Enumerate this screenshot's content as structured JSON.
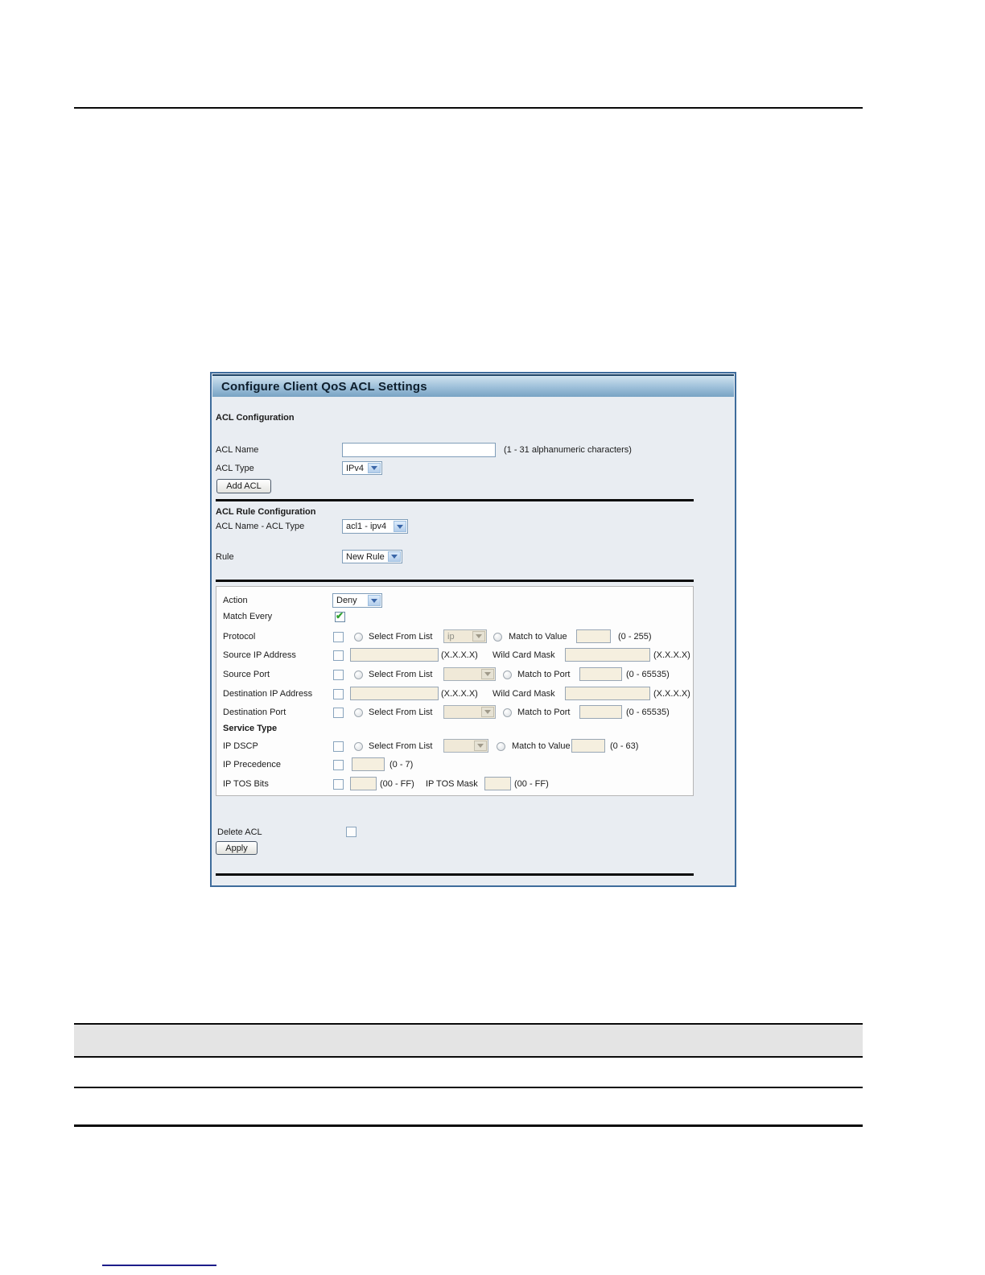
{
  "colors": {
    "panel_border": "#3f6c9c",
    "panel_bg": "#e9edf2",
    "titlebar_gradient_top": "#cfe2ef",
    "titlebar_gradient_bottom": "#78a3c4",
    "divider": "#0a0a0a",
    "disabled_field_bg": "#f5efdf",
    "checkbox_check": "#2fa12f",
    "table_header_bg": "#e4e4e4",
    "footer_link_rule": "#1c1c8a"
  },
  "panel": {
    "title": "Configure Client QoS ACL Settings",
    "acl_config": {
      "heading": "ACL Configuration",
      "acl_name_label": "ACL Name",
      "acl_name_value": "",
      "acl_name_hint": "(1 - 31 alphanumeric characters)",
      "acl_type_label": "ACL Type",
      "acl_type_value": "IPv4",
      "add_acl_button": "Add ACL"
    },
    "rule_config": {
      "heading": "ACL Rule Configuration",
      "acl_name_type_label": "ACL Name - ACL Type",
      "acl_name_type_value": "acl1 - ipv4",
      "rule_label": "Rule",
      "rule_value": "New Rule"
    },
    "rule": {
      "action_label": "Action",
      "action_value": "Deny",
      "match_every_label": "Match Every",
      "match_every_checked": true,
      "select_from_list_label": "Select From List",
      "match_to_value_label": "Match to Value",
      "match_to_port_label": "Match to Port",
      "wild_card_mask_label": "Wild Card Mask",
      "ip_format_hint": "(X.X.X.X)",
      "protocol": {
        "label": "Protocol",
        "list_value": "ip",
        "range_hint": "(0 - 255)"
      },
      "source_ip": {
        "label": "Source IP Address"
      },
      "source_port": {
        "label": "Source Port",
        "list_value": "",
        "range_hint": "(0 - 65535)"
      },
      "dest_ip": {
        "label": "Destination IP Address"
      },
      "dest_port": {
        "label": "Destination Port",
        "list_value": "",
        "range_hint": "(0 - 65535)"
      },
      "service_type_heading": "Service Type",
      "ip_dscp": {
        "label": "IP DSCP",
        "list_value": "",
        "range_hint": "(0 - 63)"
      },
      "ip_precedence": {
        "label": "IP Precedence",
        "range_hint": "(0 - 7)"
      },
      "ip_tos_bits": {
        "label": "IP TOS Bits",
        "range_hint": "(00 - FF)",
        "mask_label": "IP TOS Mask",
        "mask_range_hint": "(00 - FF)"
      }
    },
    "footer": {
      "delete_acl_label": "Delete ACL",
      "delete_acl_checked": false,
      "apply_button": "Apply"
    }
  }
}
